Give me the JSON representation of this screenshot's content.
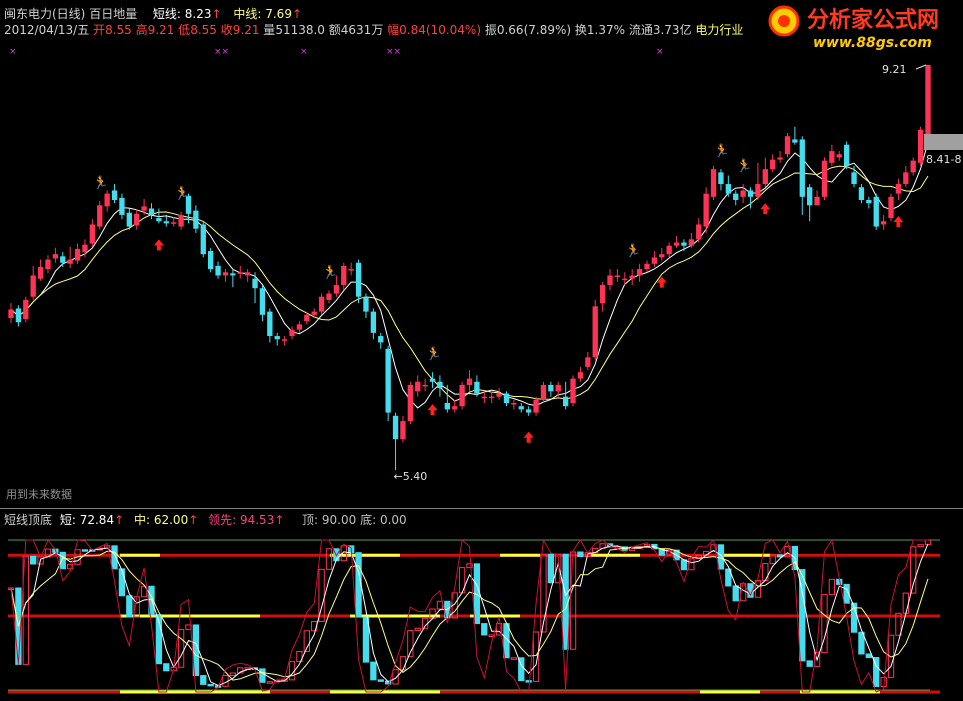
{
  "header": {
    "stock": "闽东电力(日线)",
    "indicator": "百日地量",
    "short_label": "短线:",
    "short_value": "8.23",
    "mid_label": "中线:",
    "mid_value": "7.69",
    "date": "2012/04/13/五",
    "open_label": "开",
    "open": "8.55",
    "high_label": "高",
    "high": "9.21",
    "low_label": "低",
    "low": "8.55",
    "close_label": "收",
    "close": "9.21",
    "vol_label": "量",
    "vol": "51138.0",
    "amount_label": "额",
    "amount": "4631万",
    "change_label": "幅",
    "change": "0.84(10.04%)",
    "amp": "振0.66(7.89%)",
    "turnover": "换1.37%",
    "float": "流通3.73亿",
    "sector": "电力行业",
    "arrow_glyph": "↑"
  },
  "logo": {
    "title": "分析家公式网",
    "url": "www.88gs.com",
    "bullseye_glyph": "◎"
  },
  "main": {
    "max_label": "9.21",
    "min_label": "←5.40",
    "range_label": "8.41-8",
    "footer_note": "用到未来数据",
    "runner_glyph": "🏃",
    "cross_glyph": "××"
  },
  "sub": {
    "title": "短线顶底",
    "short_label": "短:",
    "short_value": "72.84",
    "mid_label": "中:",
    "mid_value": "62.00",
    "lead_label": "领先:",
    "lead_value": "94.53",
    "top_label": "顶:",
    "top_value": "90.00",
    "bottom_label": "底:",
    "bottom_value": "0.00"
  },
  "colors": {
    "up": "#ff3355",
    "down": "#44ddee",
    "ma_short": "#ffffff",
    "ma_mid": "#ffff80",
    "signal_arrow": "#ff2020",
    "runner": "#e8a060",
    "cross": "#cc44cc",
    "sub_line_red": "#cc1010",
    "sub_line_yellow": "#ffff40",
    "sub_line_green": "#50a050"
  },
  "chart_data": {
    "type": "candlestick",
    "title": "闽东电力(日线)",
    "xlabel": "",
    "ylabel": "",
    "ylim": [
      5.4,
      9.21
    ],
    "grid": false,
    "legend": "none",
    "annotated_prices": {
      "max": 9.21,
      "min": 5.4
    },
    "last_bar": {
      "date": "2012/04/13",
      "open": 8.55,
      "high": 9.21,
      "low": 8.55,
      "close": 9.21
    },
    "candles": [
      [
        6.83,
        6.91,
        6.97,
        6.78
      ],
      [
        6.92,
        6.79,
        6.95,
        6.75
      ],
      [
        6.82,
        7.0,
        7.03,
        6.79
      ],
      [
        7.03,
        7.23,
        7.32,
        7.0
      ],
      [
        7.2,
        7.31,
        7.38,
        7.18
      ],
      [
        7.29,
        7.38,
        7.42,
        7.25
      ],
      [
        7.39,
        7.43,
        7.49,
        7.35
      ],
      [
        7.41,
        7.35,
        7.45,
        7.31
      ],
      [
        7.34,
        7.38,
        7.5,
        7.3
      ],
      [
        7.37,
        7.48,
        7.53,
        7.34
      ],
      [
        7.45,
        7.52,
        7.57,
        7.4
      ],
      [
        7.53,
        7.71,
        7.76,
        7.5
      ],
      [
        7.69,
        7.89,
        7.93,
        7.66
      ],
      [
        7.88,
        8.0,
        8.03,
        7.83
      ],
      [
        8.03,
        7.94,
        8.09,
        7.91
      ],
      [
        7.96,
        7.8,
        8.0,
        7.76
      ],
      [
        7.82,
        7.69,
        7.86,
        7.66
      ],
      [
        7.7,
        7.81,
        7.85,
        7.66
      ],
      [
        7.84,
        7.88,
        7.95,
        7.8
      ],
      [
        7.86,
        7.8,
        7.91,
        7.76
      ],
      [
        7.77,
        7.74,
        7.86,
        7.72
      ],
      [
        7.74,
        7.72,
        7.8,
        7.69
      ],
      [
        7.72,
        7.73,
        7.78,
        7.69
      ],
      [
        7.69,
        7.8,
        7.83,
        7.66
      ],
      [
        7.98,
        7.81,
        8.0,
        7.72
      ],
      [
        7.84,
        7.67,
        7.89,
        7.63
      ],
      [
        7.71,
        7.43,
        7.74,
        7.4
      ],
      [
        7.46,
        7.29,
        7.49,
        7.26
      ],
      [
        7.32,
        7.23,
        7.36,
        7.2
      ],
      [
        7.23,
        7.26,
        7.29,
        7.17
      ],
      [
        7.25,
        7.23,
        7.29,
        7.12
      ],
      [
        7.25,
        7.26,
        7.32,
        7.2
      ],
      [
        7.23,
        7.26,
        7.29,
        7.17
      ],
      [
        7.2,
        7.11,
        7.26,
        6.97
      ],
      [
        7.11,
        6.86,
        7.14,
        6.8
      ],
      [
        6.89,
        6.66,
        6.92,
        6.6
      ],
      [
        6.66,
        6.63,
        6.69,
        6.57
      ],
      [
        6.63,
        6.63,
        6.66,
        6.57
      ],
      [
        6.66,
        6.72,
        6.75,
        6.63
      ],
      [
        6.72,
        6.77,
        6.8,
        6.69
      ],
      [
        6.8,
        6.86,
        6.89,
        6.77
      ],
      [
        6.86,
        6.89,
        6.92,
        6.83
      ],
      [
        6.89,
        7.03,
        7.06,
        6.86
      ],
      [
        7.0,
        7.06,
        7.09,
        6.97
      ],
      [
        7.06,
        7.14,
        7.23,
        7.03
      ],
      [
        7.14,
        7.32,
        7.35,
        7.09
      ],
      [
        7.29,
        7.29,
        7.35,
        7.23
      ],
      [
        7.35,
        7.03,
        7.38,
        6.97
      ],
      [
        7.03,
        6.89,
        7.06,
        6.83
      ],
      [
        6.89,
        6.69,
        6.92,
        6.63
      ],
      [
        6.66,
        6.6,
        6.69,
        6.54
      ],
      [
        6.54,
        5.94,
        6.57,
        5.86
      ],
      [
        5.91,
        5.69,
        5.94,
        5.4
      ],
      [
        5.69,
        5.86,
        5.91,
        5.66
      ],
      [
        5.86,
        6.2,
        6.23,
        5.83
      ],
      [
        6.14,
        6.23,
        6.29,
        6.09
      ],
      [
        6.2,
        6.2,
        6.26,
        6.14
      ],
      [
        6.26,
        6.23,
        6.32,
        6.17
      ],
      [
        6.23,
        6.17,
        6.29,
        6.09
      ],
      [
        6.03,
        5.97,
        6.2,
        5.94
      ],
      [
        5.97,
        6.0,
        6.06,
        5.94
      ],
      [
        6.0,
        6.2,
        6.23,
        5.97
      ],
      [
        6.2,
        6.26,
        6.34,
        6.14
      ],
      [
        6.23,
        6.12,
        6.29,
        6.09
      ],
      [
        6.09,
        6.09,
        6.14,
        6.03
      ],
      [
        6.09,
        6.09,
        6.14,
        6.03
      ],
      [
        6.09,
        6.12,
        6.17,
        6.06
      ],
      [
        6.12,
        6.03,
        6.14,
        6.0
      ],
      [
        6.03,
        6.03,
        6.06,
        5.97
      ],
      [
        6.0,
        5.97,
        6.03,
        5.94
      ],
      [
        5.97,
        5.94,
        6.0,
        5.91
      ],
      [
        5.94,
        6.06,
        6.09,
        5.91
      ],
      [
        6.06,
        6.2,
        6.23,
        6.03
      ],
      [
        6.2,
        6.14,
        6.23,
        6.09
      ],
      [
        6.14,
        6.2,
        6.23,
        6.09
      ],
      [
        6.09,
        6.0,
        6.23,
        5.97
      ],
      [
        6.03,
        6.26,
        6.29,
        6.0
      ],
      [
        6.26,
        6.32,
        6.37,
        6.23
      ],
      [
        6.37,
        6.46,
        6.51,
        6.34
      ],
      [
        6.46,
        6.94,
        7.0,
        6.43
      ],
      [
        6.97,
        7.14,
        7.17,
        6.89
      ],
      [
        7.14,
        7.23,
        7.29,
        7.09
      ],
      [
        7.23,
        7.23,
        7.29,
        7.17
      ],
      [
        7.2,
        7.2,
        7.26,
        7.14
      ],
      [
        7.2,
        7.23,
        7.29,
        7.14
      ],
      [
        7.23,
        7.29,
        7.34,
        7.17
      ],
      [
        7.29,
        7.34,
        7.37,
        7.26
      ],
      [
        7.34,
        7.4,
        7.46,
        7.31
      ],
      [
        7.4,
        7.43,
        7.49,
        7.37
      ],
      [
        7.43,
        7.51,
        7.54,
        7.4
      ],
      [
        7.51,
        7.54,
        7.6,
        7.49
      ],
      [
        7.54,
        7.51,
        7.57,
        7.46
      ],
      [
        7.51,
        7.57,
        7.63,
        7.49
      ],
      [
        7.57,
        7.71,
        7.77,
        7.54
      ],
      [
        7.69,
        8.0,
        8.06,
        7.63
      ],
      [
        7.97,
        8.23,
        8.26,
        7.94
      ],
      [
        8.2,
        8.09,
        8.23,
        8.03
      ],
      [
        8.09,
        8.0,
        8.17,
        7.97
      ],
      [
        8.0,
        7.94,
        8.03,
        7.89
      ],
      [
        7.97,
        8.03,
        8.09,
        7.91
      ],
      [
        8.03,
        7.97,
        8.06,
        7.86
      ],
      [
        7.97,
        8.09,
        8.29,
        7.94
      ],
      [
        8.09,
        8.23,
        8.34,
        8.06
      ],
      [
        8.23,
        8.32,
        8.37,
        8.2
      ],
      [
        8.32,
        8.34,
        8.4,
        8.29
      ],
      [
        8.37,
        8.54,
        8.57,
        8.34
      ],
      [
        8.51,
        8.48,
        8.63,
        8.46
      ],
      [
        8.51,
        7.97,
        8.54,
        7.8
      ],
      [
        8.06,
        7.89,
        8.09,
        7.74
      ],
      [
        7.89,
        7.97,
        8.03,
        7.89
      ],
      [
        7.97,
        8.31,
        8.34,
        7.94
      ],
      [
        8.29,
        8.4,
        8.46,
        8.26
      ],
      [
        8.34,
        8.37,
        8.4,
        8.31
      ],
      [
        8.46,
        8.26,
        8.49,
        8.23
      ],
      [
        8.2,
        8.09,
        8.26,
        8.06
      ],
      [
        8.06,
        7.94,
        8.09,
        7.91
      ],
      [
        7.94,
        7.91,
        7.97,
        7.86
      ],
      [
        7.97,
        7.69,
        8.0,
        7.66
      ],
      [
        7.71,
        7.74,
        7.8,
        7.66
      ],
      [
        7.77,
        7.97,
        8.0,
        7.74
      ],
      [
        8.0,
        8.09,
        8.14,
        7.94
      ],
      [
        8.09,
        8.2,
        8.26,
        8.06
      ],
      [
        8.2,
        8.31,
        8.34,
        8.17
      ],
      [
        8.29,
        8.6,
        8.63,
        8.26
      ],
      [
        8.55,
        9.21,
        9.21,
        8.55
      ]
    ]
  }
}
